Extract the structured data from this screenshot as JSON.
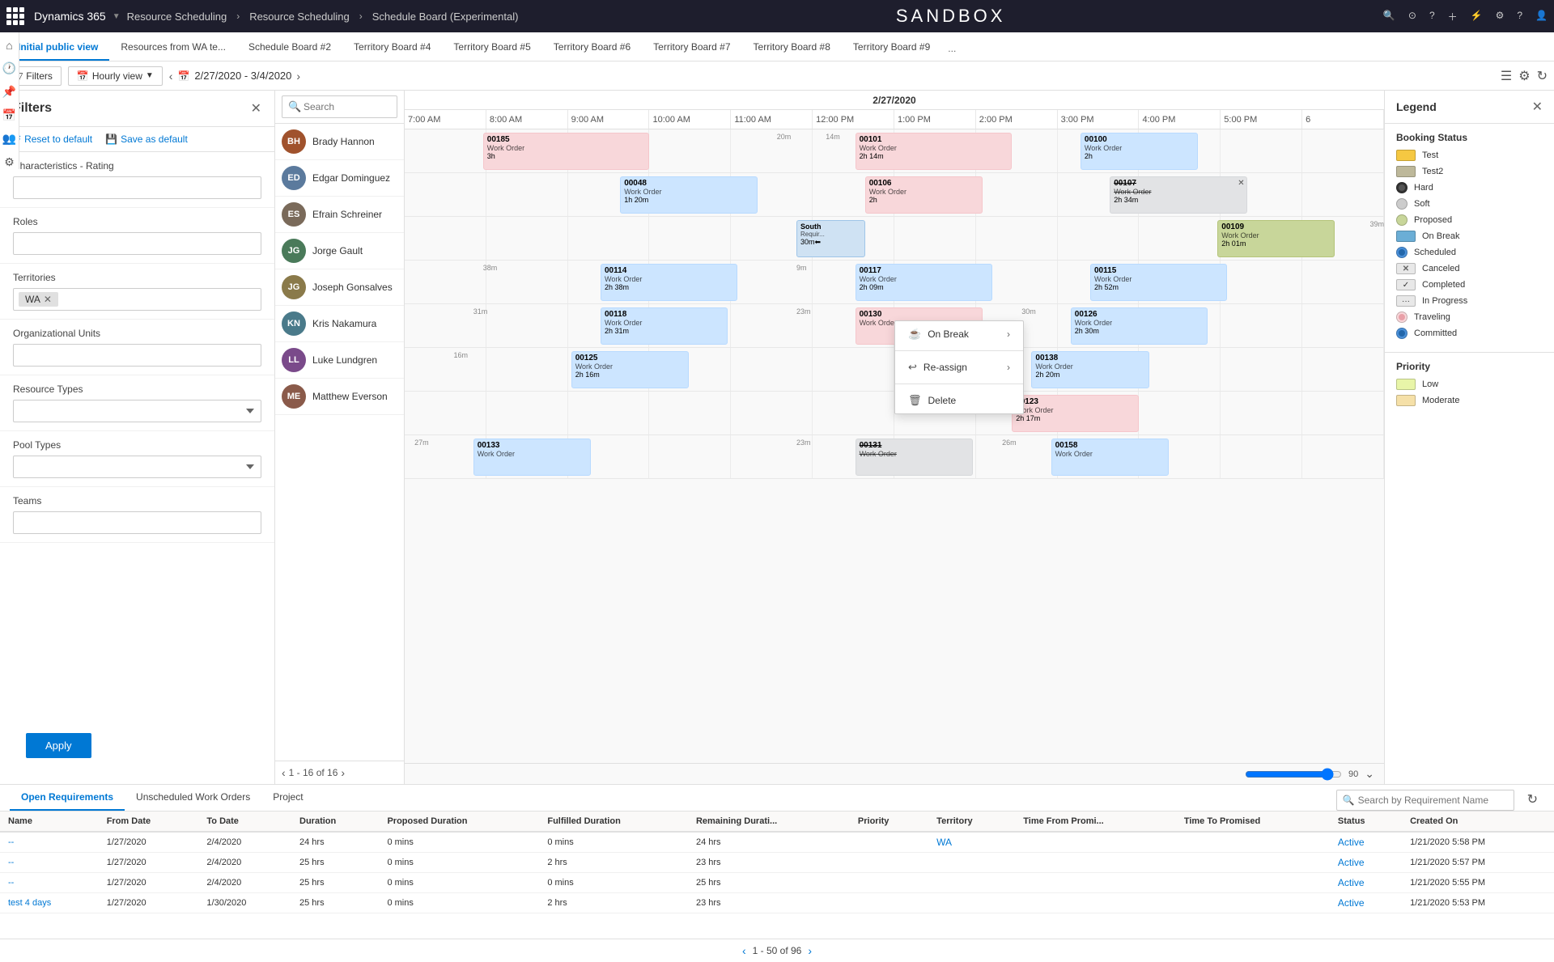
{
  "app": {
    "title": "SANDBOX",
    "nav": [
      {
        "label": "Dynamics 365"
      },
      {
        "label": "Resource Scheduling"
      },
      {
        "label": "Resource Scheduling"
      },
      {
        "label": "Schedule Board (Experimental)"
      }
    ]
  },
  "tabs": [
    {
      "label": "Initial public view",
      "active": true
    },
    {
      "label": "Resources from WA te..."
    },
    {
      "label": "Schedule Board #2"
    },
    {
      "label": "Territory Board #4"
    },
    {
      "label": "Territory Board #5"
    },
    {
      "label": "Territory Board #6"
    },
    {
      "label": "Territory Board #7"
    },
    {
      "label": "Territory Board #8"
    },
    {
      "label": "Territory Board #9"
    },
    {
      "label": "..."
    }
  ],
  "toolbar": {
    "filters_label": "Filters",
    "hourly_view_label": "Hourly view",
    "date_range": "2/27/2020 - 3/4/2020"
  },
  "filters": {
    "title": "Filters",
    "reset_label": "Reset to default",
    "save_label": "Save as default",
    "sections": [
      {
        "label": "Characteristics - Rating",
        "type": "text",
        "value": ""
      },
      {
        "label": "Roles",
        "type": "text",
        "value": ""
      },
      {
        "label": "Territories",
        "type": "tag",
        "tags": [
          "WA"
        ]
      },
      {
        "label": "Organizational Units",
        "type": "text",
        "value": ""
      },
      {
        "label": "Resource Types",
        "type": "select",
        "value": ""
      },
      {
        "label": "Pool Types",
        "type": "select",
        "value": ""
      },
      {
        "label": "Teams",
        "type": "text",
        "value": ""
      }
    ],
    "apply_label": "Apply"
  },
  "resources": {
    "search_placeholder": "Search",
    "pagination": "1 - 16 of 16",
    "items": [
      {
        "name": "Brady Hannon",
        "initials": "BH",
        "color": "#a0522d"
      },
      {
        "name": "Edgar Dominguez",
        "initials": "ED",
        "color": "#5b7a9d"
      },
      {
        "name": "Efrain Schreiner",
        "initials": "ES",
        "color": "#7a6a5a"
      },
      {
        "name": "Jorge Gault",
        "initials": "JG",
        "color": "#5a7a5a"
      },
      {
        "name": "Joseph Gonsalves",
        "initials": "JG",
        "color": "#8a7a4a"
      },
      {
        "name": "Kris Nakamura",
        "initials": "KN",
        "color": "#4a7a8a"
      },
      {
        "name": "Luke Lundgren",
        "initials": "LL",
        "color": "#7a4a8a"
      },
      {
        "name": "Matthew Everson",
        "initials": "ME",
        "color": "#8a5a4a"
      }
    ]
  },
  "schedule": {
    "date": "2/27/2020",
    "time_slots": [
      "7:00 AM",
      "8:00 AM",
      "9:00 AM",
      "10:00 AM",
      "11:00 AM",
      "12:00 PM",
      "1:00 PM",
      "2:00 PM",
      "3:00 PM",
      "4:00 PM",
      "5:00 PM",
      "6"
    ],
    "zoom_value": "90"
  },
  "context_menu": {
    "items": [
      {
        "label": "On Break",
        "icon": "☕",
        "has_arrow": true
      },
      {
        "label": "Re-assign",
        "icon": "↩",
        "has_arrow": true
      },
      {
        "label": "Delete",
        "icon": "🗑",
        "has_arrow": false
      }
    ]
  },
  "legend": {
    "title": "Legend",
    "booking_status_title": "Booking Status",
    "booking_statuses": [
      {
        "label": "Test",
        "color": "#f5c842",
        "type": "rect"
      },
      {
        "label": "Test2",
        "color": "#bdb89a",
        "type": "rect"
      },
      {
        "label": "Hard",
        "color": "#333",
        "type": "circle"
      },
      {
        "label": "Soft",
        "color": "#888",
        "type": "circle"
      },
      {
        "label": "Proposed",
        "color": "#c8d69a",
        "type": "circle"
      },
      {
        "label": "On Break",
        "color": "#6baed6",
        "type": "rect"
      },
      {
        "label": "Scheduled",
        "color": "#4a90d9",
        "type": "circle"
      },
      {
        "label": "Canceled",
        "color": "#e8e8e8",
        "type": "x"
      },
      {
        "label": "Completed",
        "color": "#e8e8e8",
        "type": "check"
      },
      {
        "label": "In Progress",
        "color": "#e8e8e8",
        "type": "dots"
      },
      {
        "label": "Traveling",
        "color": "#f8d7da",
        "type": "circle"
      },
      {
        "label": "Committed",
        "color": "#4a90d9",
        "type": "circle"
      }
    ],
    "priority_title": "Priority",
    "priorities": [
      {
        "label": "Low",
        "color": "#e8f5a8"
      },
      {
        "label": "Moderate",
        "color": "#f5e0a8"
      }
    ]
  },
  "bottom": {
    "tabs": [
      {
        "label": "Open Requirements",
        "active": true
      },
      {
        "label": "Unscheduled Work Orders"
      },
      {
        "label": "Project"
      }
    ],
    "search_placeholder": "Search by Requirement Name",
    "columns": [
      "Name",
      "From Date",
      "To Date",
      "Duration",
      "Proposed Duration",
      "Fulfilled Duration",
      "Remaining Durati...",
      "Priority",
      "Territory",
      "Time From Promi...",
      "Time To Promised",
      "Status",
      "Created On"
    ],
    "rows": [
      {
        "name": "--",
        "name_link": true,
        "from": "1/27/2020",
        "to": "2/4/2020",
        "duration": "24 hrs",
        "proposed": "0 mins",
        "fulfilled": "0 mins",
        "remaining": "24 hrs",
        "priority": "",
        "territory": "WA",
        "territory_link": true,
        "time_from": "",
        "time_to": "",
        "status": "Active",
        "created": "1/21/2020 5:58 PM"
      },
      {
        "name": "--",
        "name_link": true,
        "from": "1/27/2020",
        "to": "2/4/2020",
        "duration": "25 hrs",
        "proposed": "0 mins",
        "fulfilled": "2 hrs",
        "remaining": "23 hrs",
        "priority": "",
        "territory": "",
        "territory_link": false,
        "time_from": "",
        "time_to": "",
        "status": "Active",
        "created": "1/21/2020 5:57 PM"
      },
      {
        "name": "--",
        "name_link": true,
        "from": "1/27/2020",
        "to": "2/4/2020",
        "duration": "25 hrs",
        "proposed": "0 mins",
        "fulfilled": "0 mins",
        "remaining": "25 hrs",
        "priority": "",
        "territory": "",
        "territory_link": false,
        "time_from": "",
        "time_to": "",
        "status": "Active",
        "created": "1/21/2020 5:55 PM"
      },
      {
        "name": "test 4 days",
        "name_link": true,
        "from": "1/27/2020",
        "to": "1/30/2020",
        "duration": "25 hrs",
        "proposed": "0 mins",
        "fulfilled": "2 hrs",
        "remaining": "23 hrs",
        "priority": "",
        "territory": "",
        "territory_link": false,
        "time_from": "",
        "time_to": "",
        "status": "Active",
        "created": "1/21/2020 5:53 PM"
      }
    ],
    "pagination": "1 - 50 of 96"
  }
}
